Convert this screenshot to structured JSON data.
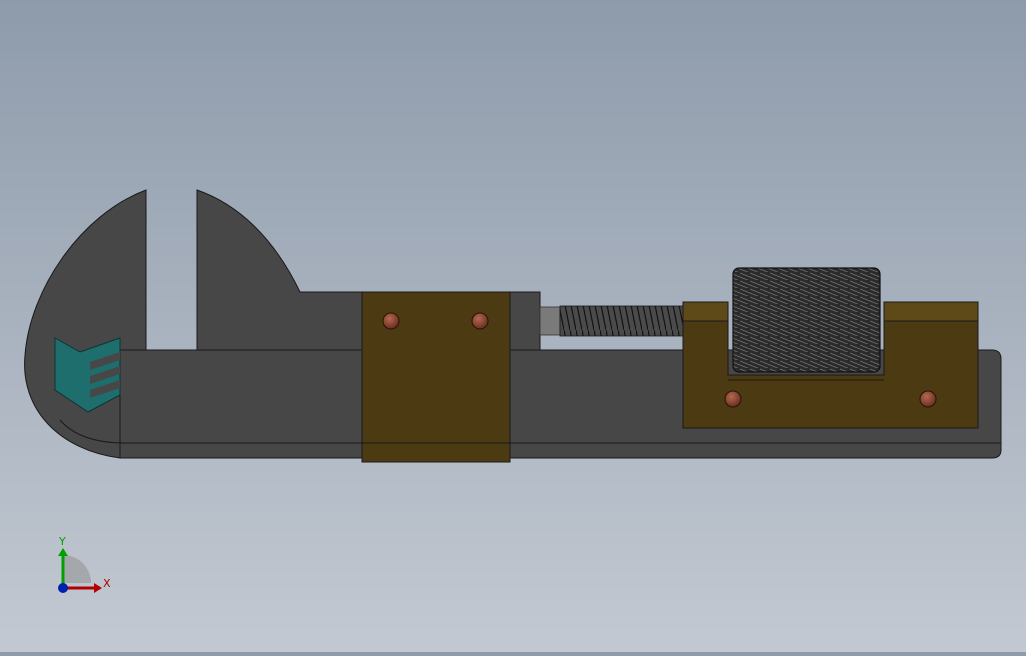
{
  "view": {
    "background_top": "#8e9bab",
    "background_bottom": "#c3c9d2"
  },
  "model": {
    "body_color": "#474747",
    "edge_color": "#1a1a1a",
    "bracket_color": "#4b3a12",
    "bracket_top_color": "#5e4a18",
    "rivet_color": "#7a3b2a",
    "logo_color": "#1f6e6e",
    "knurl_color": "#2f2f2f",
    "spring_color": "#3a3a3a",
    "screw_tip_color": "#7a7a7a"
  },
  "triad": {
    "x_label": "X",
    "y_label": "Y",
    "x_color": "#b00000",
    "y_color": "#00a000",
    "z_color": "#0020b0"
  }
}
